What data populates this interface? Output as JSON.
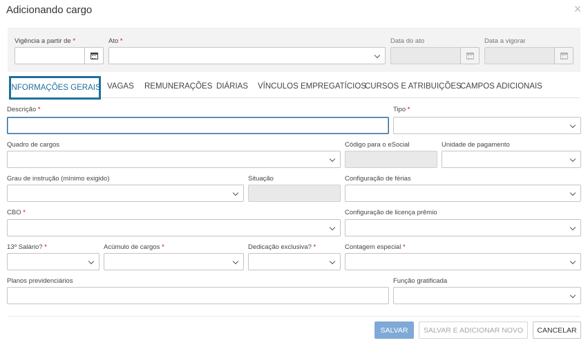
{
  "dialog": {
    "title": "Adicionando cargo",
    "close_glyph": "×"
  },
  "top": {
    "vigencia_label": "Vigência a partir de",
    "ato_label": "Ato",
    "data_ato_label": "Data do ato",
    "data_vigorar_label": "Data a vigorar",
    "required_mark": "*"
  },
  "tabs": [
    {
      "label": "INFORMAÇÕES GERAIS"
    },
    {
      "label": "VAGAS"
    },
    {
      "label": "REMUNERAÇÕES"
    },
    {
      "label": "DIÁRIAS"
    },
    {
      "label": "VÍNCULOS EMPREGATÍCIOS"
    },
    {
      "label": "CURSOS E ATRIBUIÇÕES"
    },
    {
      "label": "CAMPOS ADICIONAIS"
    }
  ],
  "form": {
    "descricao": "Descrição",
    "tipo": "Tipo",
    "quadro": "Quadro de cargos",
    "codigo_esocial": "Código para o eSocial",
    "unidade_pagamento": "Unidade de pagamento",
    "grau_instrucao": "Grau de instrução (mínimo exigido)",
    "situacao": "Situação",
    "config_ferias": "Configuração de férias",
    "cbo": "CBO",
    "config_licenca": "Configuração de licença prêmio",
    "decimo_terceiro": "13º Salário?",
    "acumulo": "Acúmulo de cargos",
    "dedicacao": "Dedicação exclusiva?",
    "contagem": "Contagem especial",
    "planos": "Planos previdenciários",
    "funcao_gratificada": "Função gratificada"
  },
  "icons": {
    "calendar": "calendar-icon",
    "chevron": "chevron-down-icon",
    "close": "close-icon"
  },
  "colors": {
    "accent": "#1d6f9e",
    "primary_button": "#7fa9d7",
    "required": "#d0021b"
  },
  "footer": {
    "salvar": "SALVAR",
    "salvar_novo": "SALVAR E ADICIONAR NOVO",
    "cancelar": "CANCELAR"
  }
}
